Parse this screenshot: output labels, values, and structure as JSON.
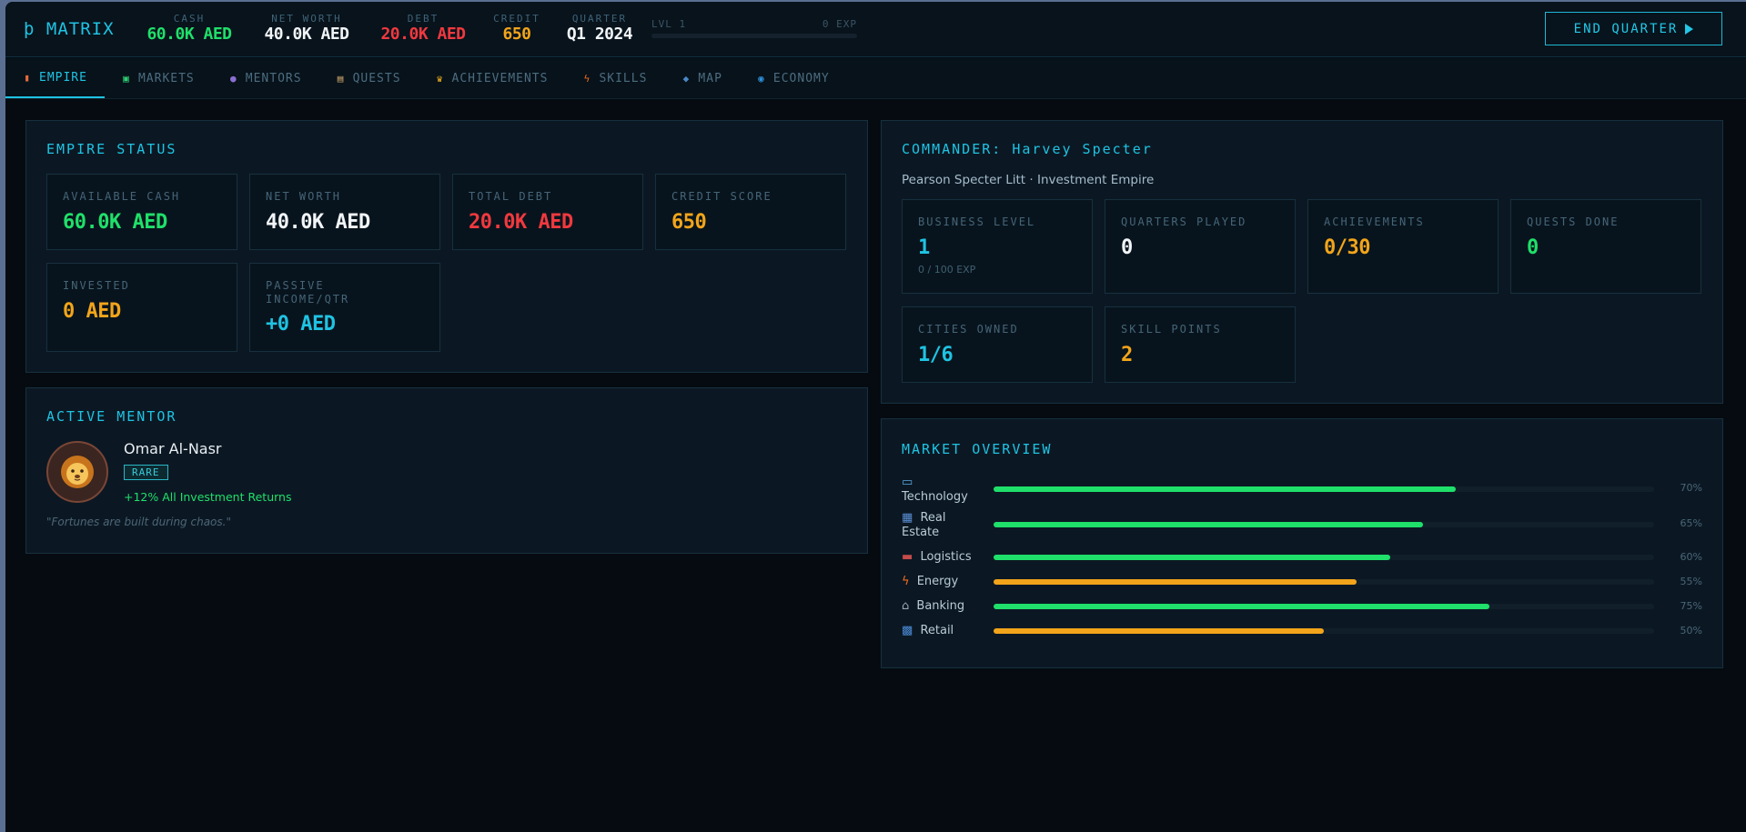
{
  "topbar": {
    "logo": "þ MATRIX",
    "stats": [
      {
        "label": "CASH",
        "value": "60.0K AED",
        "color": "#1fe06a"
      },
      {
        "label": "NET WORTH",
        "value": "40.0K AED",
        "color": "#f1f5f8"
      },
      {
        "label": "DEBT",
        "value": "20.0K AED",
        "color": "#f0393f"
      },
      {
        "label": "CREDIT",
        "value": "650",
        "color": "#f2a51a"
      },
      {
        "label": "QUARTER",
        "value": "Q1 2024",
        "color": "#f1f5f8"
      }
    ],
    "level": {
      "label": "LVL 1",
      "exp": "0 EXP",
      "progress": 0
    },
    "end_quarter": "END QUARTER"
  },
  "tabs": [
    {
      "label": "EMPIRE",
      "icon": "chart-icon",
      "glyph": "▮",
      "color": "#e36b3c"
    },
    {
      "label": "MARKETS",
      "icon": "trend-icon",
      "glyph": "▣",
      "color": "#2ecc71"
    },
    {
      "label": "MENTORS",
      "icon": "people-icon",
      "glyph": "●",
      "color": "#8a6fd0"
    },
    {
      "label": "QUESTS",
      "icon": "clipboard-icon",
      "glyph": "▤",
      "color": "#c9a36a"
    },
    {
      "label": "ACHIEVEMENTS",
      "icon": "trophy-icon",
      "glyph": "♛",
      "color": "#f2b01e"
    },
    {
      "label": "SKILLS",
      "icon": "bolt-icon",
      "glyph": "ϟ",
      "color": "#f26b1e"
    },
    {
      "label": "MAP",
      "icon": "map-icon",
      "glyph": "◆",
      "color": "#4a89c8"
    },
    {
      "label": "ECONOMY",
      "icon": "globe-icon",
      "glyph": "◉",
      "color": "#2f8fd8"
    }
  ],
  "empire_status": {
    "title": "EMPIRE STATUS",
    "cards": [
      {
        "label": "AVAILABLE CASH",
        "value": "60.0K AED",
        "color": "#1fe06a"
      },
      {
        "label": "NET WORTH",
        "value": "40.0K AED",
        "color": "#f1f5f8"
      },
      {
        "label": "TOTAL DEBT",
        "value": "20.0K AED",
        "color": "#f0393f"
      },
      {
        "label": "CREDIT SCORE",
        "value": "650",
        "color": "#f2a51a"
      },
      {
        "label": "INVESTED",
        "value": "0 AED",
        "color": "#f2a51a"
      },
      {
        "label": "PASSIVE INCOME/QTR",
        "value": "+0 AED",
        "color": "#1fc3e3"
      }
    ]
  },
  "mentor": {
    "title": "ACTIVE MENTOR",
    "avatar": "lion-icon",
    "name": "Omar Al-Nasr",
    "rarity": "RARE",
    "bonus": "+12% All Investment Returns",
    "quote": "\"Fortunes are built during chaos.\""
  },
  "commander": {
    "title": "COMMANDER: Harvey Specter",
    "subtitle": "Pearson Specter Litt · Investment Empire",
    "cards": [
      {
        "label": "BUSINESS LEVEL",
        "value": "1",
        "sub": "0 / 100 EXP",
        "color": "#1fc3e3"
      },
      {
        "label": "QUARTERS PLAYED",
        "value": "0",
        "color": "#f1f5f8"
      },
      {
        "label": "ACHIEVEMENTS",
        "value": "0/30",
        "color": "#f2a51a"
      },
      {
        "label": "QUESTS DONE",
        "value": "0",
        "color": "#1fe06a"
      },
      {
        "label": "CITIES OWNED",
        "value": "1/6",
        "color": "#1fc3e3"
      },
      {
        "label": "SKILL POINTS",
        "value": "2",
        "color": "#f2a51a"
      }
    ]
  },
  "market_overview": {
    "title": "MARKET OVERVIEW",
    "items": [
      {
        "name": "Technology",
        "icon": "laptop-icon",
        "glyph": "▭",
        "percent": 70,
        "label": "70%",
        "color": "#1fe06a"
      },
      {
        "name": "Real Estate",
        "icon": "building-icon",
        "glyph": "▦",
        "percent": 65,
        "label": "65%",
        "color": "#1fe06a"
      },
      {
        "name": "Logistics",
        "icon": "ship-icon",
        "glyph": "▬",
        "percent": 60,
        "label": "60%",
        "color": "#1fe06a"
      },
      {
        "name": "Energy",
        "icon": "bolt-icon",
        "glyph": "ϟ",
        "percent": 55,
        "label": "55%",
        "color": "#f2a51a"
      },
      {
        "name": "Banking",
        "icon": "bank-icon",
        "glyph": "⌂",
        "percent": 75,
        "label": "75%",
        "color": "#1fe06a"
      },
      {
        "name": "Retail",
        "icon": "shopping-bag-icon",
        "glyph": "▩",
        "percent": 50,
        "label": "50%",
        "color": "#f2a51a"
      }
    ]
  }
}
